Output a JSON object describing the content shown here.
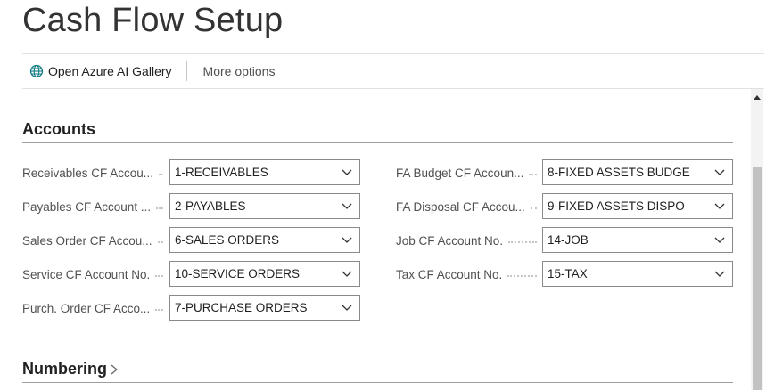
{
  "page": {
    "title": "Cash Flow Setup"
  },
  "actions": {
    "azure_label": "Open Azure AI Gallery",
    "azure_icon": "globe-icon",
    "more_label": "More options"
  },
  "sections": {
    "accounts": "Accounts",
    "numbering": "Numbering"
  },
  "left_fields": [
    {
      "label": "Receivables CF Accou...",
      "value": "1-RECEIVABLES"
    },
    {
      "label": "Payables CF Account ...",
      "value": "2-PAYABLES"
    },
    {
      "label": "Sales Order CF Accou...",
      "value": "6-SALES ORDERS"
    },
    {
      "label": "Service CF Account No.",
      "value": "10-SERVICE ORDERS"
    },
    {
      "label": "Purch. Order CF Acco...",
      "value": "7-PURCHASE ORDERS"
    }
  ],
  "right_fields": [
    {
      "label": "FA Budget CF Accoun...",
      "value": "8-FIXED ASSETS BUDGE"
    },
    {
      "label": "FA Disposal CF Accou...",
      "value": "9-FIXED ASSETS DISPO"
    },
    {
      "label": "Job CF Account No.",
      "value": "14-JOB"
    },
    {
      "label": "Tax CF Account No.",
      "value": "15-TAX"
    }
  ],
  "colors": {
    "icon_accent": "#0f7b83",
    "rule": "#9e9e9e",
    "border": "#8a8a8a"
  }
}
